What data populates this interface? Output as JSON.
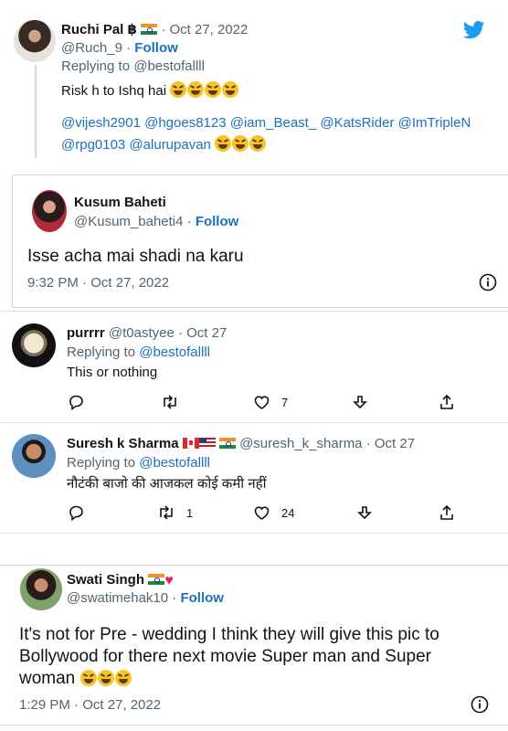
{
  "tweet1": {
    "name": "Ruchi Pal",
    "name_suffix": "฿",
    "date": "· Oct 27, 2022",
    "handle": "@Ruch_9",
    "follow_sep": "·",
    "follow": "Follow",
    "replying": "Replying to @bestofallll",
    "text": "Risk h to Ishq hai",
    "mentions_line1": "@vijesh2901 @hgoes8123 @iam_Beast_ @KatsRider @ImTripleN",
    "mentions_line2": "@rpg0103 @alurupavan"
  },
  "quote1": {
    "name": "Kusum Baheti",
    "handle": "@Kusum_baheti4",
    "follow_sep": "·",
    "follow": "Follow",
    "text": "Isse acha mai shadi na karu",
    "timestamp": "9:32 PM · Oct 27, 2022"
  },
  "reply1": {
    "name": "purrrr",
    "handle": "@t0astyee",
    "date": "· Oct 27",
    "replying_prefix": "Replying to",
    "replying_to": "@bestofallll",
    "text": "This or nothing",
    "like_count": "7"
  },
  "reply2": {
    "name": "Suresh k Sharma",
    "handle": "@suresh_k_sharma",
    "date": "· Oct 27",
    "replying_prefix": "Replying to",
    "replying_to": "@bestofallll",
    "text": "नौटंकी बाजो की आजकल कोई कमी नहीं",
    "retweet_count": "1",
    "like_count": "24"
  },
  "quote2": {
    "name": "Swati Singh",
    "handle": "@swatimehak10",
    "follow_sep": "·",
    "follow": "Follow",
    "text_line1": "It's not for Pre - wedding I think they will give this pic to",
    "text_line2": "Bollywood for there next movie Super man and Super",
    "text_line3": "woman",
    "timestamp": "1:29 PM · Oct 27, 2022"
  },
  "icons": {
    "brand": "twitter-bird-icon",
    "reply": "reply-icon",
    "retweet": "retweet-icon",
    "like": "like-icon",
    "bookmark": "bookmark-icon",
    "share": "share-icon",
    "info": "info-icon"
  },
  "colors": {
    "link": "#1d6fc0",
    "twitter_blue": "#1d9bf0",
    "muted": "#536471",
    "border": "#cfd9de"
  }
}
